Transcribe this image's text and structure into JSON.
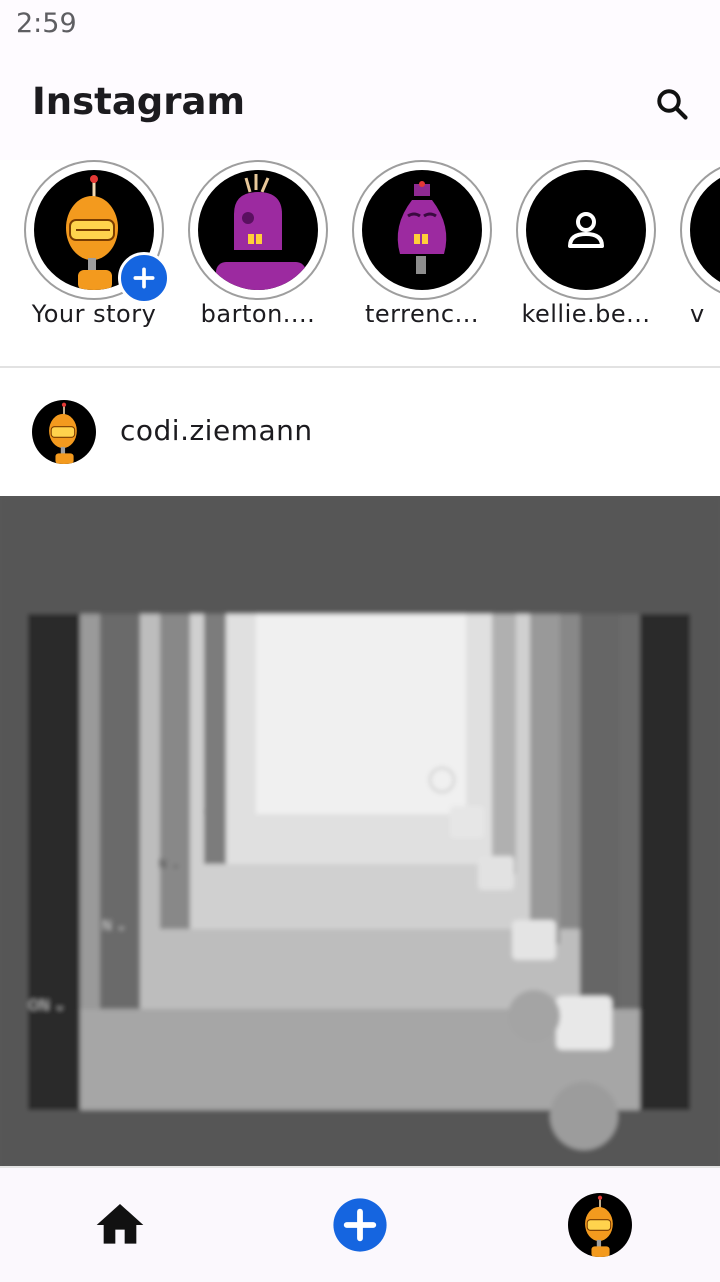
{
  "status_bar": {
    "time": "2:59"
  },
  "app_bar": {
    "title": "Instagram",
    "search_icon": "search-icon"
  },
  "stories": [
    {
      "label": "Your story",
      "avatar": "orange-robot",
      "has_add_badge": true
    },
    {
      "label": "barton....",
      "avatar": "purple-robot"
    },
    {
      "label": "terrenc...",
      "avatar": "purple-robot-hat"
    },
    {
      "label": "kellie.be...",
      "avatar": "person-placeholder"
    },
    {
      "label": "v",
      "avatar": "unknown"
    }
  ],
  "post": {
    "username": "codi.ziemann",
    "image_alt": "blurred grayscale screenshot"
  },
  "bottom_nav": {
    "items": [
      "home-icon",
      "add-circle-icon",
      "profile-avatar"
    ]
  },
  "colors": {
    "accent": "#1565e0",
    "app_bar_bg": "#fefbff",
    "text": "#1c1b1f",
    "post_bg": "#575757"
  }
}
